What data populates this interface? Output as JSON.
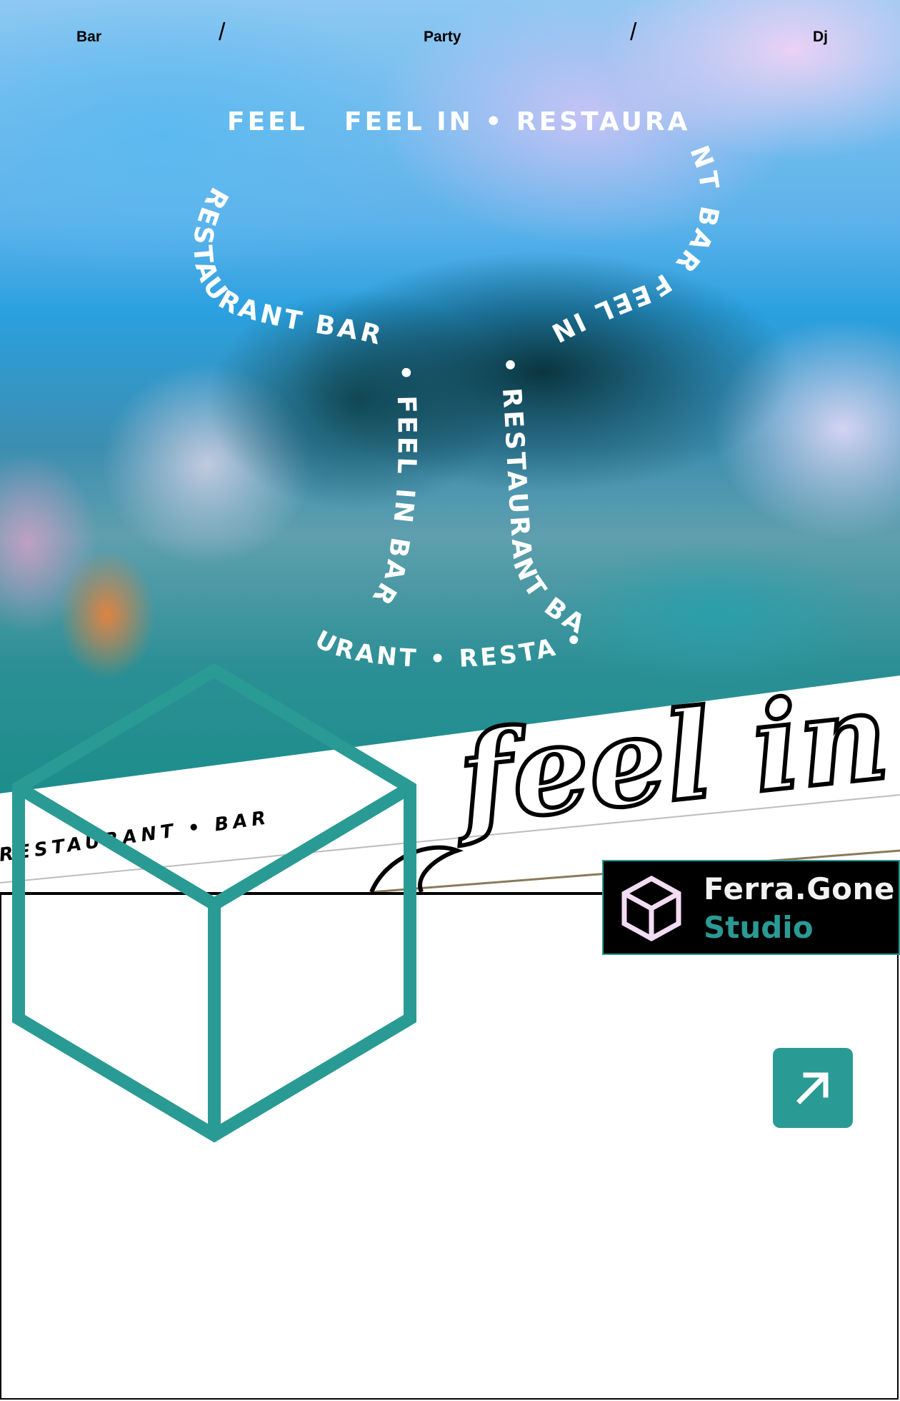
{
  "nav": {
    "items": [
      {
        "label": "Bar"
      },
      {
        "label": "Party"
      },
      {
        "label": "Dj"
      }
    ],
    "separator": "/"
  },
  "hero": {
    "glass_text_top_left": "FEEL",
    "glass_text_top_right": "FEEL IN • RESTAURA",
    "glass_text_left_side": "RESTAURANT BAR",
    "glass_text_right_side": "NT BAR FEEL IN",
    "glass_text_left_stem": "• FEEL IN BAR",
    "glass_text_right_stem": "• RESTAURANT BAR",
    "glass_text_bottom": "URANT • RESTA • FEEL IN • RESTA"
  },
  "sign": {
    "script_text": "feel in",
    "sub_text": "RESTAURANT • BAR"
  },
  "brand": {
    "name": "Ferra.Gone",
    "sub": "Studio",
    "icon": "cube-icon"
  },
  "action": {
    "icon": "arrow-up-right-icon"
  },
  "colors": {
    "accent": "#2a9a94",
    "brand_bg": "#000000",
    "brand_text": "#f2f2f2",
    "mini_cube": "#f3dcf3"
  }
}
